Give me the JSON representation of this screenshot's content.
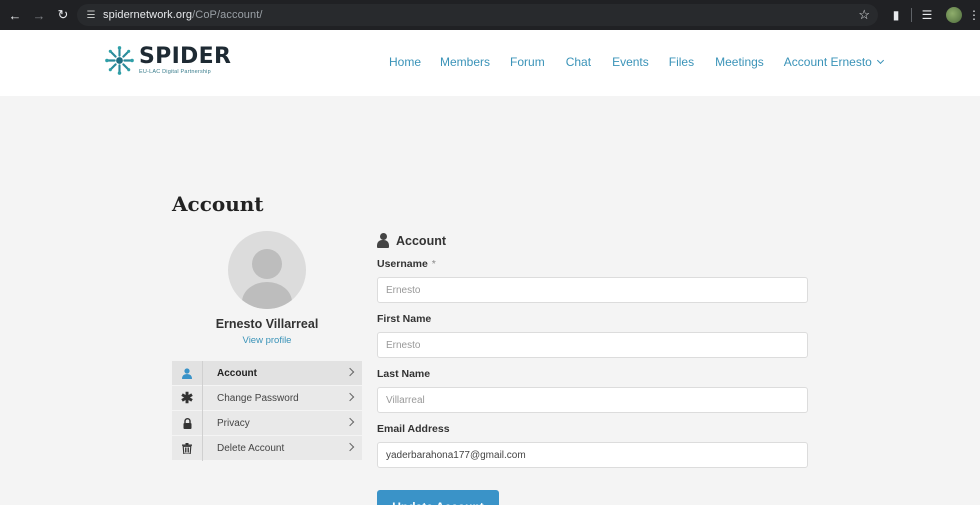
{
  "browser": {
    "url_host": "spidernetwork.org",
    "url_path": "/CoP/account/",
    "icons": [
      "back-arrow-icon",
      "forward-arrow-icon",
      "reload-icon",
      "site-settings-icon",
      "bookmark-star-icon",
      "extensions-icon",
      "media-controls-icon",
      "profile-avatar",
      "kebab-menu-icon"
    ]
  },
  "header": {
    "logo_title": "SPIDER",
    "logo_subtitle": "EU-LAC Digital Partnership",
    "nav": [
      "Home",
      "Members",
      "Forum",
      "Chat",
      "Events",
      "Files",
      "Meetings"
    ],
    "account_menu_label": "Account Ernesto"
  },
  "page": {
    "title": "Account"
  },
  "profile": {
    "name": "Ernesto Villarreal",
    "view_profile_label": "View profile"
  },
  "side_menu": [
    {
      "label": "Account",
      "icon": "user-icon",
      "active": true
    },
    {
      "label": "Change Password",
      "icon": "asterisk-icon",
      "active": false
    },
    {
      "label": "Privacy",
      "icon": "lock-icon",
      "active": false
    },
    {
      "label": "Delete Account",
      "icon": "trash-icon",
      "active": false
    }
  ],
  "form": {
    "heading": "Account",
    "username_label": "Username",
    "username_required_mark": "*",
    "username_value": "Ernesto",
    "first_name_label": "First Name",
    "first_name_value": "Ernesto",
    "last_name_label": "Last Name",
    "last_name_value": "Villarreal",
    "email_label": "Email Address",
    "email_value": "yaderbarahona177@gmail.com",
    "submit_label": "Update Account"
  },
  "colors": {
    "accent": "#3a93b8",
    "button": "#3a93c8",
    "browser_chrome": "#202124",
    "page_background": "#f4f4f4"
  }
}
